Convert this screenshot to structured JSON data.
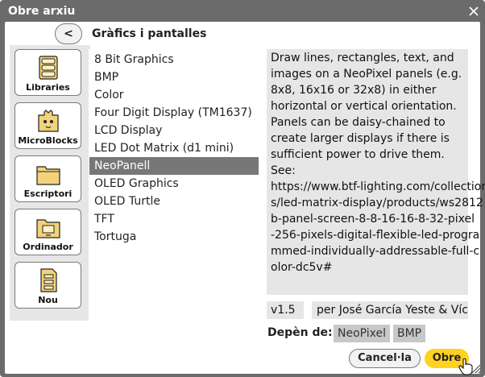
{
  "dialog": {
    "title": "Obre arxiu",
    "back_label": "<",
    "heading": "Gràfics i pantalles"
  },
  "sidebar": {
    "items": [
      {
        "label": "Libraries",
        "icon": "book-icon"
      },
      {
        "label": "MicroBlocks",
        "icon": "microblocks-icon"
      },
      {
        "label": "Escriptori",
        "icon": "folder-icon"
      },
      {
        "label": "Ordinador",
        "icon": "computer-folder-icon"
      },
      {
        "label": "Nou",
        "icon": "new-file-icon"
      }
    ]
  },
  "libraries": {
    "items": [
      "8 Bit Graphics",
      "BMP",
      "Color",
      "Four Digit Display (TM1637)",
      "LCD Display",
      "LED Dot Matrix (d1 mini)",
      "NeoPanell",
      "OLED Graphics",
      "OLED Turtle",
      "TFT",
      "Tortuga"
    ],
    "selected": "NeoPanell"
  },
  "details": {
    "description_lines": [
      "Draw lines, rectangles, text, and",
      "images on a NeoPixel panels (e.g.",
      "8x8, 16x16 or 32x8) in either",
      "horizontal or vertical orientation.",
      "Panels can be daisy-chained to",
      "create larger displays if there is",
      "sufficient power to drive them.",
      "See:",
      "https://www.btf-lighting.com/collection",
      "s/led-matrix-display/products/ws2812",
      "b-panel-screen-8-8-16-16-8-32-pixel",
      "-256-pixels-digital-flexible-led-progra",
      "mmed-individually-addressable-full-c",
      "olor-dc5v#"
    ],
    "version": "v1.5",
    "author": "per José García Yeste & Víctor",
    "depends_label": "Depèn de:",
    "depends": [
      "NeoPixel",
      "BMP"
    ]
  },
  "buttons": {
    "cancel": "Cancel·la",
    "open": "Obre"
  },
  "colors": {
    "frame": "#6b6b6b",
    "selected": "#777777",
    "panel": "#e6e6e6",
    "accent": "#ffd21f"
  }
}
